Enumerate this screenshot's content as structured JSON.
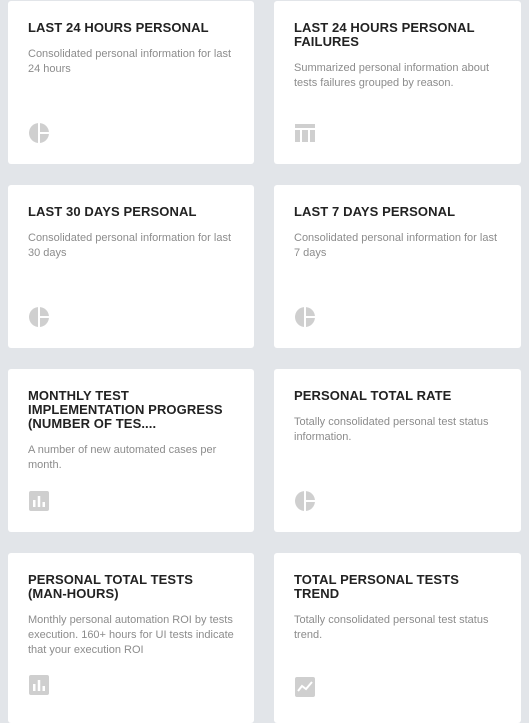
{
  "widgets": [
    {
      "title": "LAST 24 HOURS PERSONAL",
      "description": "Consolidated personal information for last 24 hours",
      "icon": "pie-chart-icon"
    },
    {
      "title": "LAST 24 HOURS PERSONAL FAILURES",
      "description": "Summarized personal information about tests failures grouped by reason.",
      "icon": "table-icon"
    },
    {
      "title": "LAST 30 DAYS PERSONAL",
      "description": "Consolidated personal information for last 30 days",
      "icon": "pie-chart-icon"
    },
    {
      "title": "LAST 7 DAYS PERSONAL",
      "description": "Consolidated personal information for last 7 days",
      "icon": "pie-chart-icon"
    },
    {
      "title": "MONTHLY TEST IMPLEMENTATION PROGRESS (NUMBER OF TES....",
      "description": "A number of new automated cases per month.",
      "icon": "bar-chart-icon"
    },
    {
      "title": "PERSONAL TOTAL RATE",
      "description": "Totally consolidated personal test status information.",
      "icon": "pie-chart-icon"
    },
    {
      "title": "PERSONAL TOTAL TESTS (MAN-HOURS)",
      "description": "Monthly personal automation ROI by tests execution. 160+ hours for UI tests indicate that your execution ROI",
      "icon": "bar-chart-icon"
    },
    {
      "title": "TOTAL PERSONAL TESTS TREND",
      "description": "Totally consolidated personal test status trend.",
      "icon": "line-chart-icon"
    }
  ],
  "colors": {
    "background": "#e2e5e9",
    "card": "#ffffff",
    "title": "#222222",
    "description": "#8c8c8c",
    "icon": "#cfcfcf"
  }
}
